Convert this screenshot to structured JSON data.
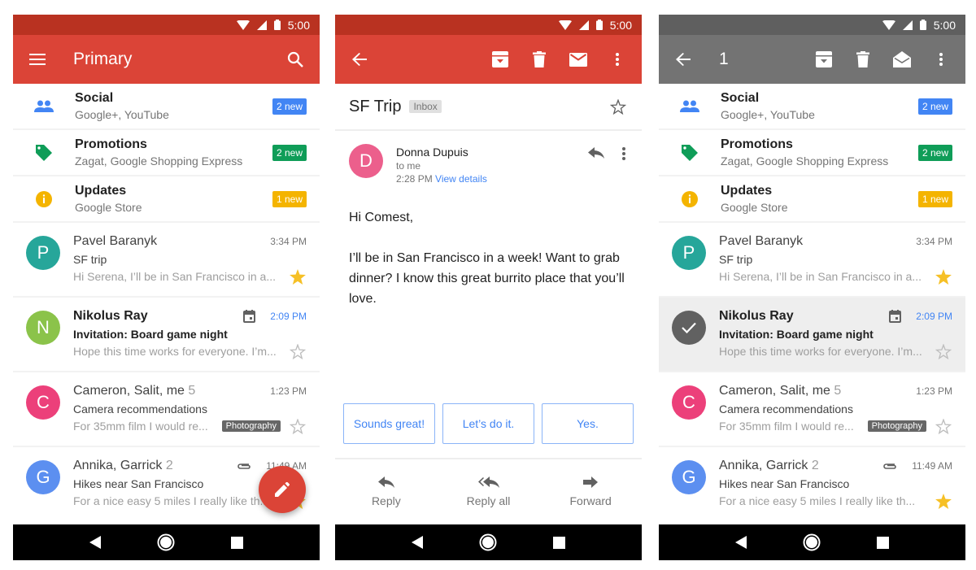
{
  "status_bar": {
    "time": "5:00"
  },
  "colors": {
    "primary_red": "#db4437",
    "status_red": "#b93221",
    "selection_grey": "#737373",
    "blue": "#4285f4",
    "green": "#0f9d58",
    "yellow": "#f4b400",
    "star_yellow": "#f6c026"
  },
  "inbox": {
    "title": "Primary",
    "menu_icon": "menu-icon",
    "search_icon": "search-icon",
    "categories": [
      {
        "title": "Social",
        "subtitle": "Google+, YouTube",
        "badge": "2 new",
        "icon": "people-icon",
        "color": "#4285f4"
      },
      {
        "title": "Promotions",
        "subtitle": "Zagat, Google Shopping Express",
        "badge": "2 new",
        "icon": "tag-icon",
        "color": "#0f9d58"
      },
      {
        "title": "Updates",
        "subtitle": "Google Store",
        "badge": "1 new",
        "icon": "info-icon",
        "color": "#f4b400"
      }
    ],
    "emails": [
      {
        "initial": "P",
        "avatar_color": "#26a69a",
        "sender": "Pavel Baranyk",
        "count": "",
        "subject": "SF trip",
        "snippet": "Hi Serena, I’ll be in San Francisco in a...",
        "time": "3:34 PM",
        "unread": false,
        "starred": true,
        "label": "",
        "meta_icon": ""
      },
      {
        "initial": "N",
        "avatar_color": "#8bc34a",
        "sender": "Nikolus Ray",
        "count": "",
        "subject": "Invitation: Board game night",
        "snippet": "Hope this time works for everyone. I’m...",
        "time": "2:09 PM",
        "unread": true,
        "starred": false,
        "label": "",
        "meta_icon": "calendar-icon"
      },
      {
        "initial": "C",
        "avatar_color": "#ec407a",
        "sender": "Cameron, Salit, me",
        "count": "5",
        "subject": "Camera recommendations",
        "snippet": "For 35mm film I would re...",
        "time": "1:23 PM",
        "unread": false,
        "starred": false,
        "label": "Photography",
        "meta_icon": ""
      },
      {
        "initial": "G",
        "avatar_color": "#5c8ff0",
        "sender": "Annika, Garrick",
        "count": "2",
        "subject": "Hikes near San Francisco",
        "snippet": "For a nice easy 5 miles I really like th...",
        "time": "11:49 AM",
        "unread": false,
        "starred": true,
        "label": "",
        "meta_icon": "attachment-icon"
      }
    ],
    "fab_icon": "pencil-icon"
  },
  "thread": {
    "title": "SF Trip",
    "label": "Inbox",
    "message": {
      "initial": "D",
      "avatar_color": "#ec5f8c",
      "from": "Donna Dupuis",
      "to": "to me",
      "time": "2:28 PM",
      "view_details": "View details",
      "greeting": "Hi Comest,",
      "body": "I’ll be in San Francisco in a week! Want to grab dinner? I know this great burrito place that you’ll love."
    },
    "smart_replies": [
      "Sounds great!",
      "Let’s do it.",
      "Yes."
    ],
    "actions": [
      {
        "label": "Reply",
        "icon": "reply-icon"
      },
      {
        "label": "Reply all",
        "icon": "reply-all-icon"
      },
      {
        "label": "Forward",
        "icon": "forward-icon"
      }
    ]
  },
  "selection": {
    "count": "1",
    "selected_index": 1
  }
}
